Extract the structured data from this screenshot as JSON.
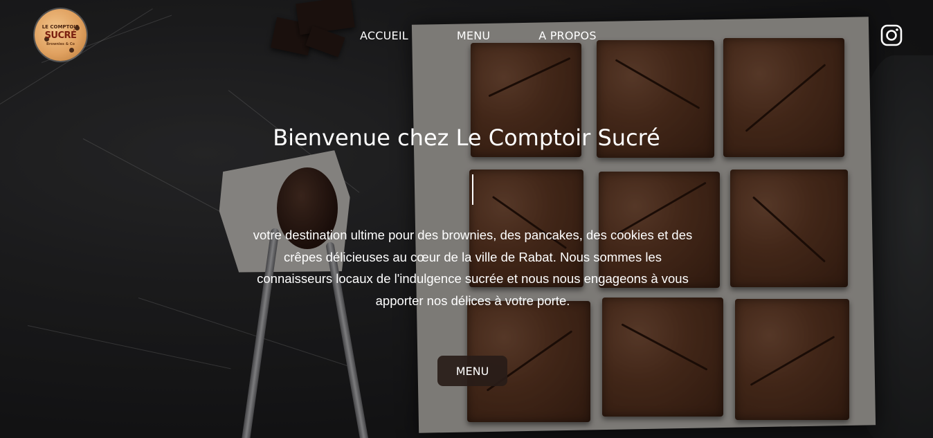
{
  "logo": {
    "line1": "LE COMPTOIR",
    "line2": "SUCRÉ",
    "line3": "Brownies & Co"
  },
  "nav": {
    "items": [
      {
        "label": "ACCUEIL"
      },
      {
        "label": "MENU"
      },
      {
        "label": "A PROPOS"
      }
    ]
  },
  "social": {
    "icon": "instagram-icon"
  },
  "hero": {
    "title": "Bienvenue chez Le Comptoir Sucré",
    "intro": "votre destination ultime pour des brownies, des pancakes, des cookies et des crêpes délicieuses au cœur de la ville de Rabat. Nous sommes les connaisseurs locaux de l'indulgence sucrée et nous nous engageons à vous apporter nos délices à votre porte.",
    "cta_label": "MENU"
  },
  "colors": {
    "text": "#ffffff",
    "button_bg": "#281c18",
    "background": "#1f1f21"
  }
}
